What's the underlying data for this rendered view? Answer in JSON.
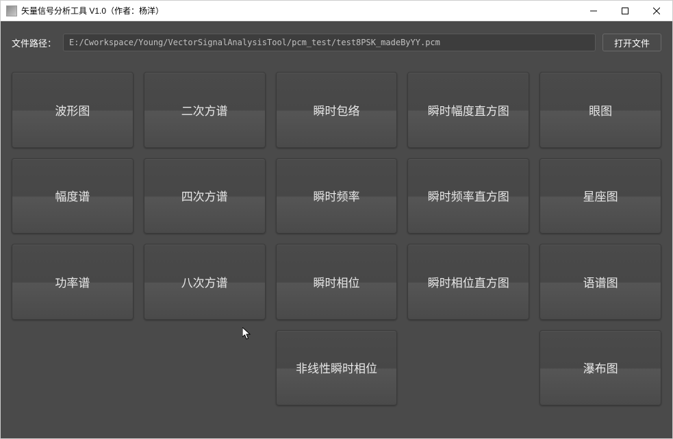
{
  "window": {
    "title": "矢量信号分析工具 V1.0（作者：杨洋）"
  },
  "filepath": {
    "label": "文件路径：",
    "value": "E:/Cworkspace/Young/VectorSignalAnalysisTool/pcm_test/test8PSK_madeByYY.pcm",
    "open_button": "打开文件"
  },
  "buttons": {
    "r0c0": "波形图",
    "r0c1": "二次方谱",
    "r0c2": "瞬时包络",
    "r0c3": "瞬时幅度直方图",
    "r0c4": "眼图",
    "r1c0": "幅度谱",
    "r1c1": "四次方谱",
    "r1c2": "瞬时频率",
    "r1c3": "瞬时频率直方图",
    "r1c4": "星座图",
    "r2c0": "功率谱",
    "r2c1": "八次方谱",
    "r2c2": "瞬时相位",
    "r2c3": "瞬时相位直方图",
    "r2c4": "语谱图",
    "r3c2": "非线性瞬时相位",
    "r3c4": "瀑布图"
  }
}
